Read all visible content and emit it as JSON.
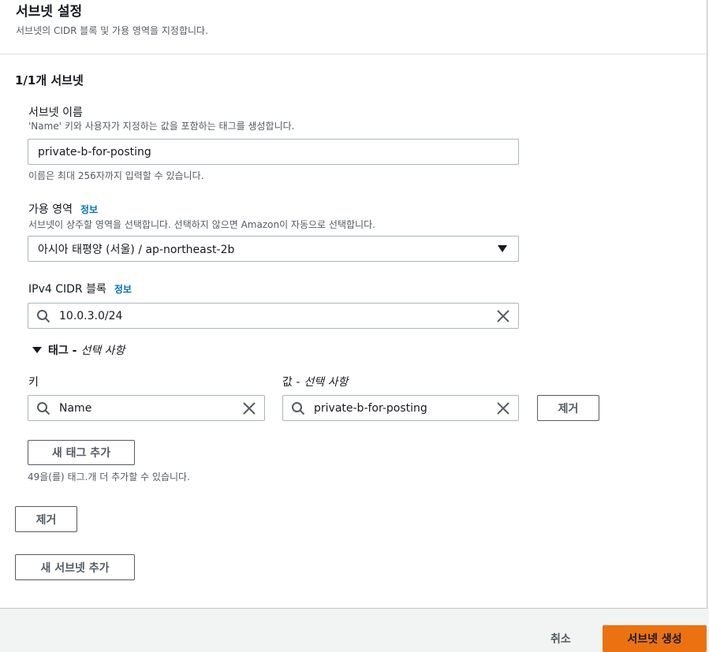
{
  "section": {
    "title": "서브넷 설정",
    "description": "서브넷의 CIDR 블록 및 가용 영역을 지정합니다."
  },
  "subnet": {
    "heading": "1/1개 서브넷",
    "name": {
      "label": "서브넷 이름",
      "description": "'Name' 키와 사용자가 지정하는 값을 포함하는 태그를 생성합니다.",
      "value": "private-b-for-posting",
      "constraint": "이름은 최대 256자까지 입력할 수 있습니다."
    },
    "az": {
      "label": "가용 영역",
      "info": "정보",
      "description": "서브넷이 상주할 영역을 선택합니다. 선택하지 않으면 Amazon이 자동으로 선택합니다.",
      "value": "아시아 태평양 (서울) / ap-northeast-2b"
    },
    "cidr": {
      "label": "IPv4 CIDR 블록",
      "info": "정보",
      "value": "10.0.3.0/24"
    },
    "tags": {
      "toggle_label": "태그 -",
      "toggle_optional": "선택 사항",
      "key_label": "키",
      "value_label_prefix": "값 -",
      "value_label_optional": "선택 사항",
      "key_value": "Name",
      "value_value": "private-b-for-posting",
      "remove_label": "제거",
      "add_label": "새 태그 추가",
      "remaining_hint": "49을(를) 태그.개 더 추가할 수 있습니다."
    },
    "remove_label": "제거"
  },
  "add_subnet_label": "새 서브넷 추가",
  "footer": {
    "cancel_label": "취소",
    "create_label": "서브넷 생성"
  },
  "colors": {
    "link": "#0073bb",
    "primary": "#ec7211"
  }
}
